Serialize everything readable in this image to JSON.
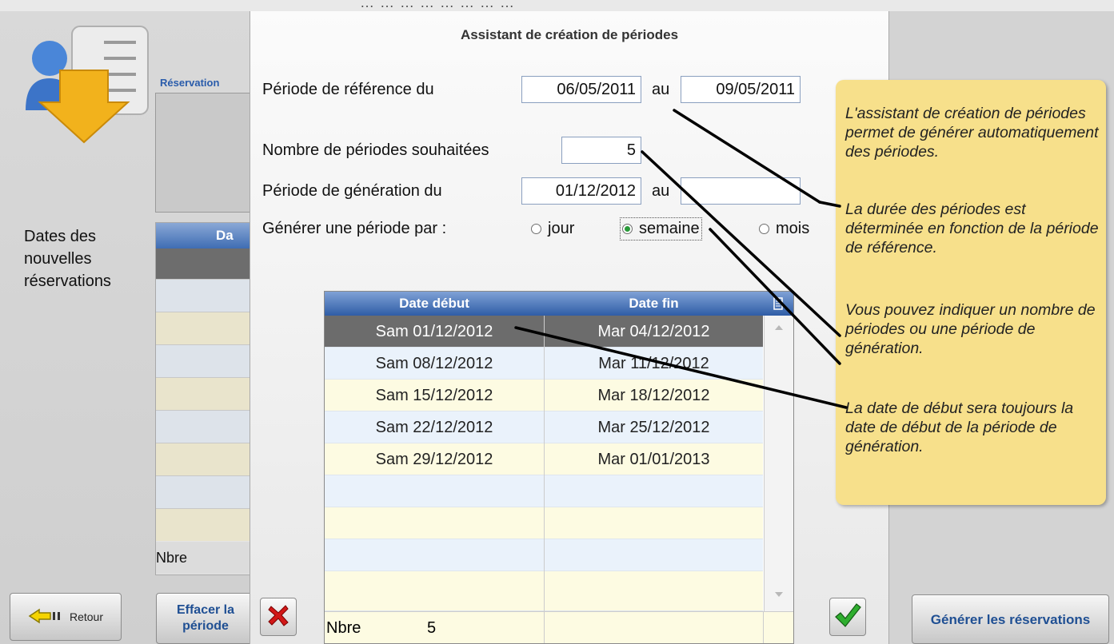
{
  "topbar": {
    "text": "… … … … … … … …"
  },
  "background": {
    "reservation_label": "Réservation",
    "dates_label": "Dates des nouvelles réservations",
    "grid_header": "Da",
    "nbre_label": "Nbre",
    "retour_label": "Retour",
    "effacer_label": "Effacer la période",
    "generer_label": "Générer les réservations"
  },
  "dialog": {
    "title": "Assistant de création de périodes",
    "ref_label": "Période de référence du",
    "ref_from": "06/05/2011",
    "au_label": "au",
    "ref_to": "09/05/2011",
    "count_label": "Nombre de périodes souhaitées",
    "count_value": "5",
    "gen_label": "Période de génération du",
    "gen_from": "01/12/2012",
    "gen_to": "",
    "per_label": "Générer une période par :",
    "options": [
      "jour",
      "semaine",
      "mois"
    ],
    "selected_option": "semaine",
    "table": {
      "headers": [
        "Date début",
        "Date fin"
      ],
      "rows": [
        [
          "Sam 01/12/2012",
          "Mar 04/12/2012"
        ],
        [
          "Sam 08/12/2012",
          "Mar 11/12/2012"
        ],
        [
          "Sam 15/12/2012",
          "Mar 18/12/2012"
        ],
        [
          "Sam 22/12/2012",
          "Mar 25/12/2012"
        ],
        [
          "Sam 29/12/2012",
          "Mar 01/01/2013"
        ]
      ],
      "footer_label": "Nbre",
      "footer_value": "5"
    }
  },
  "tooltip": {
    "p1": "L'assistant de création de périodes permet de générer automatiquement des périodes.",
    "p2": "La durée des périodes est déterminée en fonction de la période de référence.",
    "p3": "Vous pouvez indiquer un nombre de périodes ou une période de génération.",
    "p4": "La date de début sera toujours la date de début de la période de génération."
  },
  "colors": {
    "header_blue": "#2f5da6",
    "tooltip": "#f7e08b",
    "selected_row": "#6c6c6c"
  },
  "icons": [
    "user-download-icon",
    "arrow-left-icon",
    "cancel-x-icon",
    "checkmark-icon",
    "column-menu-icon",
    "scroll-up-icon",
    "scroll-down-icon"
  ]
}
